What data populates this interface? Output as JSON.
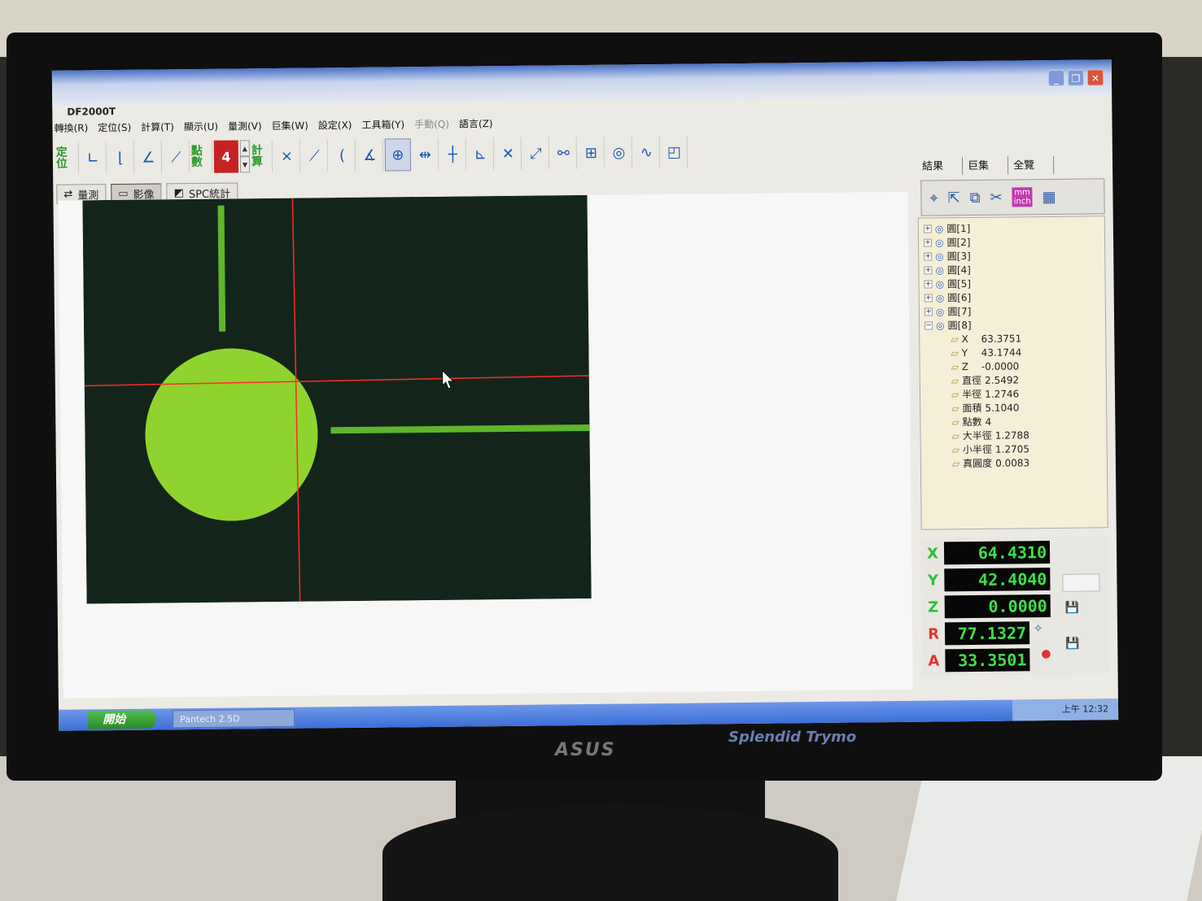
{
  "window": {
    "title": "DF2000T"
  },
  "menu": [
    "轉換(R)",
    "定位(S)",
    "計算(T)",
    "顯示(U)",
    "量測(V)",
    "巨集(W)",
    "設定(X)",
    "工具箱(Y)",
    "手動(Q)",
    "語言(Z)"
  ],
  "toolbar": {
    "locate_label": "定位",
    "points_label": "點數",
    "points_value": "4",
    "calc_label": "計算"
  },
  "view_tabs": [
    "量測",
    "影像",
    "SPC統計"
  ],
  "right_tabs": [
    "結果",
    "巨集",
    "全覽"
  ],
  "units": {
    "metric": "mm",
    "imperial": "inch"
  },
  "tree": {
    "circles": [
      "圓[1]",
      "圓[2]",
      "圓[3]",
      "圓[4]",
      "圓[5]",
      "圓[6]",
      "圓[7]"
    ],
    "expanded": {
      "label": "圓[8]",
      "fields": [
        {
          "key": "X",
          "value": "63.3751"
        },
        {
          "key": "Y",
          "value": "43.1744"
        },
        {
          "key": "Z",
          "value": "-0.0000"
        },
        {
          "key": "直徑",
          "value": "2.5492"
        },
        {
          "key": "半徑",
          "value": "1.2746"
        },
        {
          "key": "面積",
          "value": "5.1040"
        },
        {
          "key": "點數",
          "value": "4"
        },
        {
          "key": "大半徑",
          "value": "1.2788"
        },
        {
          "key": "小半徑",
          "value": "1.2705"
        },
        {
          "key": "真圓度",
          "value": "0.0083"
        }
      ]
    }
  },
  "readout": {
    "X": "64.4310",
    "Y": "42.4040",
    "Z": "0.0000",
    "R": "77.1327",
    "A": "33.3501"
  },
  "readout_colors": {
    "X": "#2bbf3a",
    "Y": "#2bbf3a",
    "Z": "#2bbf3a",
    "R": "#e23434",
    "A": "#e23434"
  },
  "taskbar": {
    "start": "開始",
    "task": "Pantech 2.5D",
    "clock": "上午 12:32"
  },
  "monitor": {
    "brand": "ASUS",
    "badge": "Splendid Trymo"
  }
}
